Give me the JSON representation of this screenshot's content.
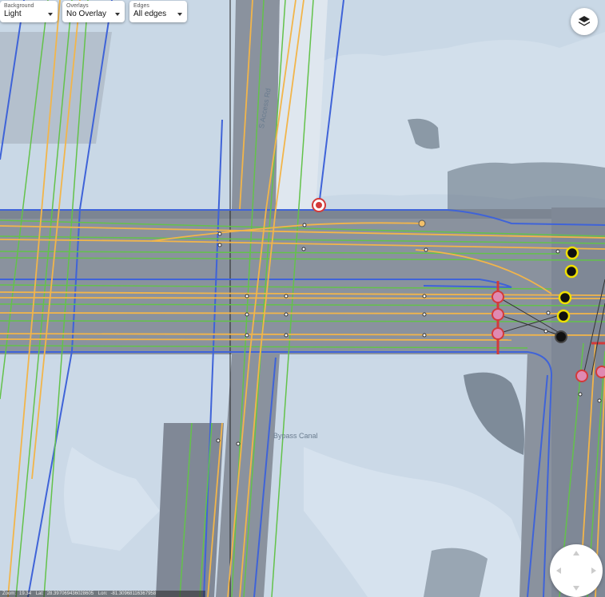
{
  "controls": {
    "background": {
      "label": "Background",
      "value": "Light"
    },
    "overlays": {
      "label": "Overlays",
      "value": "No Overlay"
    },
    "edges": {
      "label": "Edges",
      "value": "All edges"
    }
  },
  "map_labels": {
    "road": "S Access Rd",
    "canal": "Bypass Canal"
  },
  "status": {
    "zoom_label": "Zoom:",
    "zoom": "19.34",
    "lat_label": "Lat:",
    "lat": "28.397069436028605",
    "lon_label": "Lon:",
    "lon": "-81.30968116367958"
  },
  "colors": {
    "edge_yellow": "#f2b54a",
    "edge_green": "#63c24a",
    "edge_blue": "#3f63d8",
    "node_pink": "#e08ab2",
    "node_red": "#d33a3a",
    "node_yellow": "#f0e000",
    "road_gray": "#8a929e",
    "water": "#c9d8e6"
  },
  "icons": {
    "layers": "layers-icon",
    "nav": "navigation-pad-icon",
    "stop": "stop-sign-icon"
  }
}
